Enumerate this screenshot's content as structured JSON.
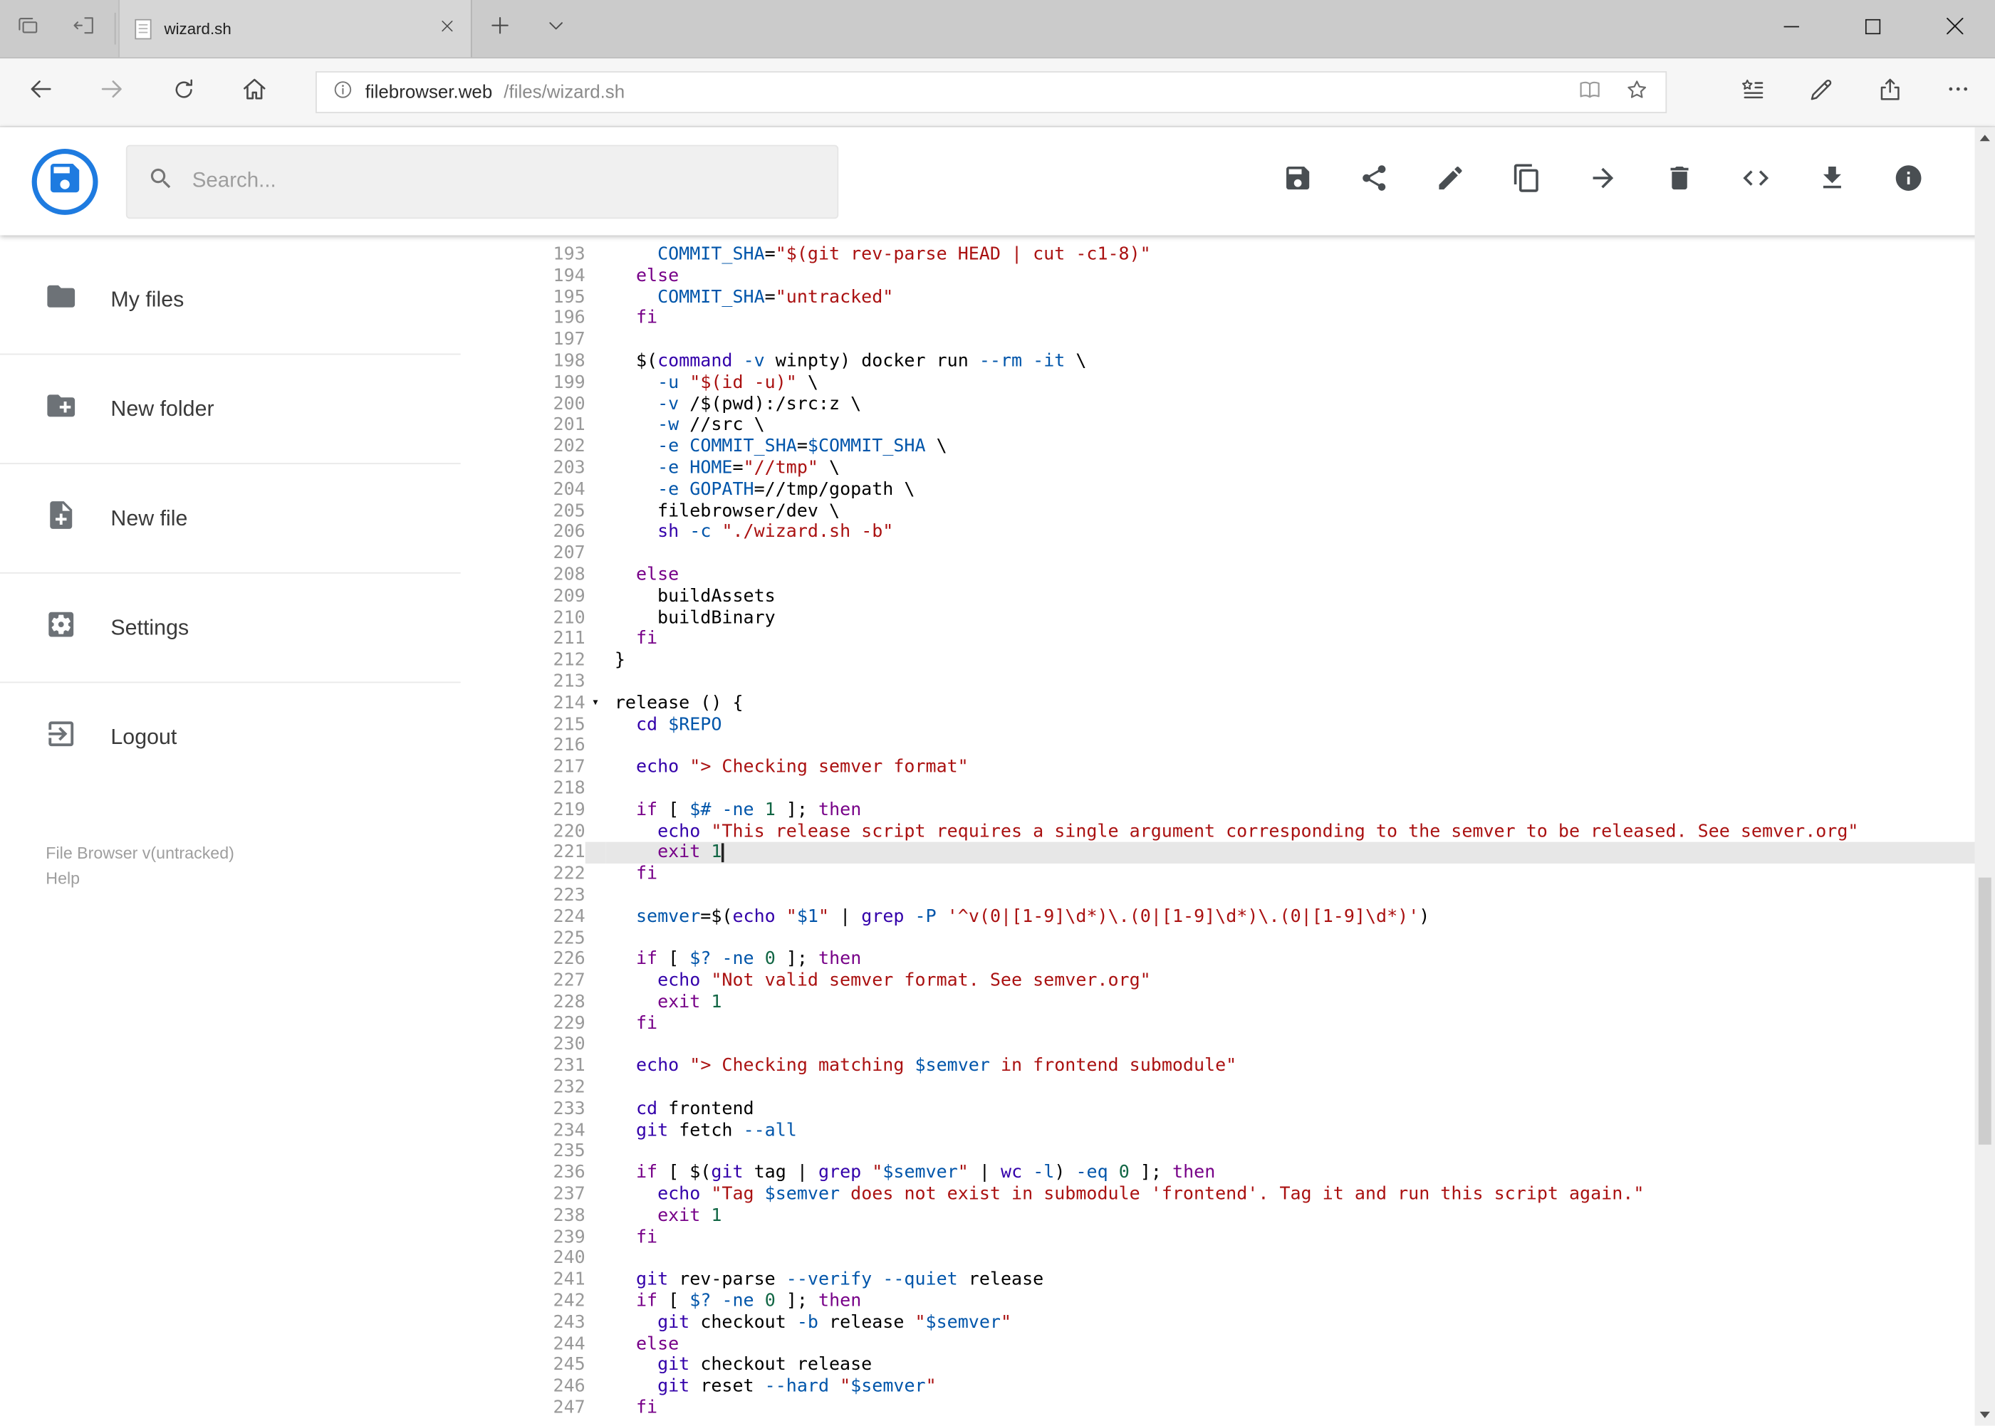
{
  "browser": {
    "tab": {
      "title": "wizard.sh"
    },
    "url": {
      "host": "filebrowser.web",
      "path": "/files/wizard.sh"
    },
    "icons": {
      "strip_left": [
        "tab-preview",
        "set-tabs-aside"
      ],
      "tab": [
        "page",
        "close"
      ],
      "strip_right": [
        "new-tab",
        "tab-list-chevron"
      ],
      "window": [
        "minimize",
        "maximize",
        "close"
      ],
      "nav": [
        "back",
        "forward",
        "refresh",
        "home"
      ],
      "address": [
        "site-info",
        "reading-view",
        "favorite-star"
      ],
      "nav_right": [
        "hub-favorites",
        "web-note-pen",
        "share",
        "more"
      ]
    }
  },
  "app": {
    "logo": "file-browser-floppy",
    "search_placeholder": "Search...",
    "toolbar_icons": [
      "save",
      "share",
      "rename",
      "copy",
      "move",
      "delete",
      "code",
      "download",
      "info"
    ],
    "sidebar": {
      "items": [
        {
          "icon": "folder",
          "label": "My files"
        },
        {
          "icon": "create-new-folder",
          "label": "New folder"
        },
        {
          "icon": "new-file",
          "label": "New file"
        },
        {
          "icon": "settings",
          "label": "Settings"
        },
        {
          "icon": "logout",
          "label": "Logout"
        }
      ],
      "footer": {
        "version": "File Browser v(untracked)",
        "help": "Help"
      }
    }
  },
  "editor": {
    "first_line": 193,
    "last_line": 247,
    "active_line": 221,
    "fold_line": 214,
    "fold_glyph": "▾",
    "token_colors": {
      "keyword": "#708",
      "builtin": "#30a",
      "string": "#a11",
      "variable": "#05a",
      "number": "#164"
    },
    "lines": [
      {
        "n": 193,
        "s": [
          [
            "    ",
            ""
          ],
          [
            "COMMIT_SHA",
            "v"
          ],
          [
            "=",
            ""
          ],
          [
            "\"$(git rev-parse HEAD | cut -c1-8)\"",
            "s"
          ]
        ]
      },
      {
        "n": 194,
        "s": [
          [
            "  ",
            ""
          ],
          [
            "else",
            "k"
          ]
        ]
      },
      {
        "n": 195,
        "s": [
          [
            "    ",
            ""
          ],
          [
            "COMMIT_SHA",
            "v"
          ],
          [
            "=",
            ""
          ],
          [
            "\"untracked\"",
            "s"
          ]
        ]
      },
      {
        "n": 196,
        "s": [
          [
            "  ",
            ""
          ],
          [
            "fi",
            "k"
          ]
        ]
      },
      {
        "n": 197,
        "s": []
      },
      {
        "n": 198,
        "s": [
          [
            "  $(",
            ""
          ],
          [
            "command",
            "b"
          ],
          [
            " ",
            ""
          ],
          [
            "-v",
            "v"
          ],
          [
            " winpty) docker run ",
            ""
          ],
          [
            "--rm",
            "v"
          ],
          [
            " ",
            ""
          ],
          [
            "-it",
            "v"
          ],
          [
            " \\",
            ""
          ]
        ]
      },
      {
        "n": 199,
        "s": [
          [
            "    ",
            ""
          ],
          [
            "-u",
            "v"
          ],
          [
            " ",
            ""
          ],
          [
            "\"$(id -u)\"",
            "s"
          ],
          [
            " \\",
            ""
          ]
        ]
      },
      {
        "n": 200,
        "s": [
          [
            "    ",
            ""
          ],
          [
            "-v",
            "v"
          ],
          [
            " /$(pwd):/src:z \\",
            ""
          ]
        ]
      },
      {
        "n": 201,
        "s": [
          [
            "    ",
            ""
          ],
          [
            "-w",
            "v"
          ],
          [
            " //src \\",
            ""
          ]
        ]
      },
      {
        "n": 202,
        "s": [
          [
            "    ",
            ""
          ],
          [
            "-e",
            "v"
          ],
          [
            " ",
            ""
          ],
          [
            "COMMIT_SHA",
            "v"
          ],
          [
            "=",
            ""
          ],
          [
            "$COMMIT_SHA",
            "v"
          ],
          [
            " \\",
            ""
          ]
        ]
      },
      {
        "n": 203,
        "s": [
          [
            "    ",
            ""
          ],
          [
            "-e",
            "v"
          ],
          [
            " ",
            ""
          ],
          [
            "HOME",
            "v"
          ],
          [
            "=",
            ""
          ],
          [
            "\"//tmp\"",
            "s"
          ],
          [
            " \\",
            ""
          ]
        ]
      },
      {
        "n": 204,
        "s": [
          [
            "    ",
            ""
          ],
          [
            "-e",
            "v"
          ],
          [
            " ",
            ""
          ],
          [
            "GOPATH",
            "v"
          ],
          [
            "=//tmp/gopath \\",
            ""
          ]
        ]
      },
      {
        "n": 205,
        "s": [
          [
            "    filebrowser/dev \\",
            ""
          ]
        ]
      },
      {
        "n": 206,
        "s": [
          [
            "    ",
            ""
          ],
          [
            "sh",
            "b"
          ],
          [
            " ",
            ""
          ],
          [
            "-c",
            "v"
          ],
          [
            " ",
            ""
          ],
          [
            "\"./wizard.sh -b\"",
            "s"
          ]
        ]
      },
      {
        "n": 207,
        "s": []
      },
      {
        "n": 208,
        "s": [
          [
            "  ",
            ""
          ],
          [
            "else",
            "k"
          ]
        ]
      },
      {
        "n": 209,
        "s": [
          [
            "    buildAssets",
            ""
          ]
        ]
      },
      {
        "n": 210,
        "s": [
          [
            "    buildBinary",
            ""
          ]
        ]
      },
      {
        "n": 211,
        "s": [
          [
            "  ",
            ""
          ],
          [
            "fi",
            "k"
          ]
        ]
      },
      {
        "n": 212,
        "s": [
          [
            "}",
            ""
          ]
        ]
      },
      {
        "n": 213,
        "s": []
      },
      {
        "n": 214,
        "fold": true,
        "s": [
          [
            "release () {",
            ""
          ]
        ]
      },
      {
        "n": 215,
        "s": [
          [
            "  ",
            ""
          ],
          [
            "cd",
            "b"
          ],
          [
            " ",
            ""
          ],
          [
            "$REPO",
            "v"
          ]
        ]
      },
      {
        "n": 216,
        "s": []
      },
      {
        "n": 217,
        "s": [
          [
            "  ",
            ""
          ],
          [
            "echo",
            "b"
          ],
          [
            " ",
            ""
          ],
          [
            "\"> Checking semver format\"",
            "s"
          ]
        ]
      },
      {
        "n": 218,
        "s": []
      },
      {
        "n": 219,
        "s": [
          [
            "  ",
            ""
          ],
          [
            "if",
            "k"
          ],
          [
            " [ ",
            ""
          ],
          [
            "$#",
            "v"
          ],
          [
            " ",
            ""
          ],
          [
            "-ne",
            "v"
          ],
          [
            " ",
            ""
          ],
          [
            "1",
            "n"
          ],
          [
            " ]; ",
            ""
          ],
          [
            "then",
            "k"
          ]
        ]
      },
      {
        "n": 220,
        "s": [
          [
            "    ",
            ""
          ],
          [
            "echo",
            "b"
          ],
          [
            " ",
            ""
          ],
          [
            "\"This release script requires a single argument corresponding to the semver to be released. See semver.org\"",
            "s"
          ]
        ]
      },
      {
        "n": 221,
        "s": [
          [
            "    ",
            ""
          ],
          [
            "exit",
            "k"
          ],
          [
            " ",
            ""
          ],
          [
            "1",
            "n"
          ]
        ]
      },
      {
        "n": 222,
        "s": [
          [
            "  ",
            ""
          ],
          [
            "fi",
            "k"
          ]
        ]
      },
      {
        "n": 223,
        "s": []
      },
      {
        "n": 224,
        "s": [
          [
            "  ",
            ""
          ],
          [
            "semver",
            "v"
          ],
          [
            "=$(",
            ""
          ],
          [
            "echo",
            "b"
          ],
          [
            " ",
            ""
          ],
          [
            "\"",
            "s"
          ],
          [
            "$1",
            "v"
          ],
          [
            "\"",
            "s"
          ],
          [
            " | ",
            ""
          ],
          [
            "grep",
            "b"
          ],
          [
            " ",
            ""
          ],
          [
            "-P",
            "v"
          ],
          [
            " ",
            ""
          ],
          [
            "'^v(0|[1-9]\\d*)\\.(0|[1-9]\\d*)\\.(0|[1-9]\\d*)'",
            "s"
          ],
          [
            ")",
            ""
          ]
        ]
      },
      {
        "n": 225,
        "s": []
      },
      {
        "n": 226,
        "s": [
          [
            "  ",
            ""
          ],
          [
            "if",
            "k"
          ],
          [
            " [ ",
            ""
          ],
          [
            "$?",
            "v"
          ],
          [
            " ",
            ""
          ],
          [
            "-ne",
            "v"
          ],
          [
            " ",
            ""
          ],
          [
            "0",
            "n"
          ],
          [
            " ]; ",
            ""
          ],
          [
            "then",
            "k"
          ]
        ]
      },
      {
        "n": 227,
        "s": [
          [
            "    ",
            ""
          ],
          [
            "echo",
            "b"
          ],
          [
            " ",
            ""
          ],
          [
            "\"Not valid semver format. See semver.org\"",
            "s"
          ]
        ]
      },
      {
        "n": 228,
        "s": [
          [
            "    ",
            ""
          ],
          [
            "exit",
            "k"
          ],
          [
            " ",
            ""
          ],
          [
            "1",
            "n"
          ]
        ]
      },
      {
        "n": 229,
        "s": [
          [
            "  ",
            ""
          ],
          [
            "fi",
            "k"
          ]
        ]
      },
      {
        "n": 230,
        "s": []
      },
      {
        "n": 231,
        "s": [
          [
            "  ",
            ""
          ],
          [
            "echo",
            "b"
          ],
          [
            " ",
            ""
          ],
          [
            "\"> Checking matching ",
            "s"
          ],
          [
            "$semver",
            "v"
          ],
          [
            " in frontend submodule\"",
            "s"
          ]
        ]
      },
      {
        "n": 232,
        "s": []
      },
      {
        "n": 233,
        "s": [
          [
            "  ",
            ""
          ],
          [
            "cd",
            "b"
          ],
          [
            " frontend",
            ""
          ]
        ]
      },
      {
        "n": 234,
        "s": [
          [
            "  ",
            ""
          ],
          [
            "git",
            "b"
          ],
          [
            " fetch ",
            ""
          ],
          [
            "--all",
            "v"
          ]
        ]
      },
      {
        "n": 235,
        "s": []
      },
      {
        "n": 236,
        "s": [
          [
            "  ",
            ""
          ],
          [
            "if",
            "k"
          ],
          [
            " [ $(",
            ""
          ],
          [
            "git",
            "b"
          ],
          [
            " tag | ",
            ""
          ],
          [
            "grep",
            "b"
          ],
          [
            " ",
            ""
          ],
          [
            "\"",
            "s"
          ],
          [
            "$semver",
            "v"
          ],
          [
            "\"",
            "s"
          ],
          [
            " | ",
            ""
          ],
          [
            "wc",
            "b"
          ],
          [
            " ",
            ""
          ],
          [
            "-l",
            "v"
          ],
          [
            ") ",
            ""
          ],
          [
            "-eq",
            "v"
          ],
          [
            " ",
            ""
          ],
          [
            "0",
            "n"
          ],
          [
            " ]; ",
            ""
          ],
          [
            "then",
            "k"
          ]
        ]
      },
      {
        "n": 237,
        "s": [
          [
            "    ",
            ""
          ],
          [
            "echo",
            "b"
          ],
          [
            " ",
            ""
          ],
          [
            "\"Tag ",
            "s"
          ],
          [
            "$semver",
            "v"
          ],
          [
            " does not exist in submodule 'frontend'. Tag it and run this script again.\"",
            "s"
          ]
        ]
      },
      {
        "n": 238,
        "s": [
          [
            "    ",
            ""
          ],
          [
            "exit",
            "k"
          ],
          [
            " ",
            ""
          ],
          [
            "1",
            "n"
          ]
        ]
      },
      {
        "n": 239,
        "s": [
          [
            "  ",
            ""
          ],
          [
            "fi",
            "k"
          ]
        ]
      },
      {
        "n": 240,
        "s": []
      },
      {
        "n": 241,
        "s": [
          [
            "  ",
            ""
          ],
          [
            "git",
            "b"
          ],
          [
            " rev-parse ",
            ""
          ],
          [
            "--verify",
            "v"
          ],
          [
            " ",
            ""
          ],
          [
            "--quiet",
            "v"
          ],
          [
            " release",
            ""
          ]
        ]
      },
      {
        "n": 242,
        "s": [
          [
            "  ",
            ""
          ],
          [
            "if",
            "k"
          ],
          [
            " [ ",
            ""
          ],
          [
            "$?",
            "v"
          ],
          [
            " ",
            ""
          ],
          [
            "-ne",
            "v"
          ],
          [
            " ",
            ""
          ],
          [
            "0",
            "n"
          ],
          [
            " ]; ",
            ""
          ],
          [
            "then",
            "k"
          ]
        ]
      },
      {
        "n": 243,
        "s": [
          [
            "    ",
            ""
          ],
          [
            "git",
            "b"
          ],
          [
            " checkout ",
            ""
          ],
          [
            "-b",
            "v"
          ],
          [
            " release ",
            ""
          ],
          [
            "\"",
            "s"
          ],
          [
            "$semver",
            "v"
          ],
          [
            "\"",
            "s"
          ]
        ]
      },
      {
        "n": 244,
        "s": [
          [
            "  ",
            ""
          ],
          [
            "else",
            "k"
          ]
        ]
      },
      {
        "n": 245,
        "s": [
          [
            "    ",
            ""
          ],
          [
            "git",
            "b"
          ],
          [
            " checkout release",
            ""
          ]
        ]
      },
      {
        "n": 246,
        "s": [
          [
            "    ",
            ""
          ],
          [
            "git",
            "b"
          ],
          [
            " reset ",
            ""
          ],
          [
            "--hard",
            "v"
          ],
          [
            " ",
            ""
          ],
          [
            "\"",
            "s"
          ],
          [
            "$semver",
            "v"
          ],
          [
            "\"",
            "s"
          ]
        ]
      },
      {
        "n": 247,
        "s": [
          [
            "  ",
            ""
          ],
          [
            "fi",
            "k"
          ]
        ]
      }
    ]
  }
}
